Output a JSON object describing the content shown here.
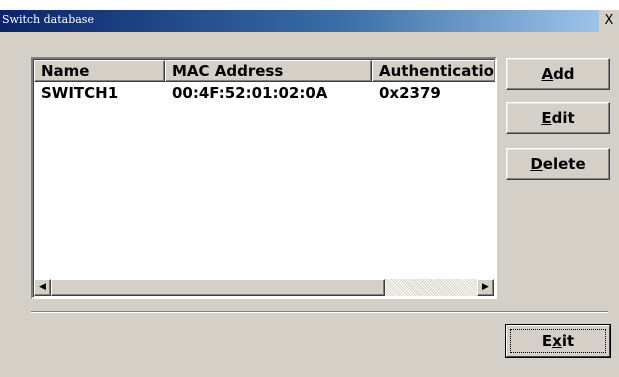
{
  "window": {
    "title": "Switch database",
    "close_glyph": "X"
  },
  "list": {
    "columns": [
      "Name",
      "MAC Address",
      "Authenticatio"
    ],
    "rows": [
      [
        "SWITCH1",
        "00:4F:52:01:02:0A",
        "0x2379"
      ]
    ],
    "scroll_left_glyph": "◀",
    "scroll_right_glyph": "▶"
  },
  "buttons": {
    "add": {
      "accel": "A",
      "rest": "dd"
    },
    "edit": {
      "accel": "E",
      "rest": "dit"
    },
    "delete": {
      "accel": "D",
      "rest": "elete"
    },
    "exit": {
      "pre": "E",
      "accel": "x",
      "rest": "it"
    }
  }
}
